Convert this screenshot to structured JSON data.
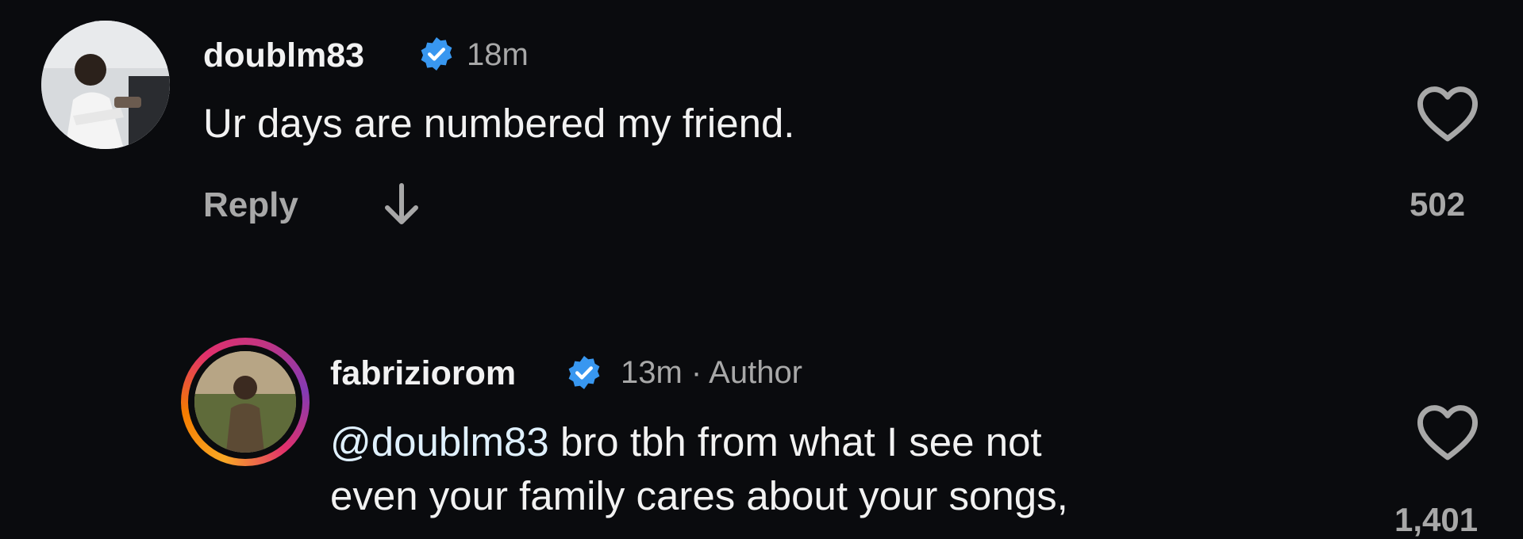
{
  "comments": [
    {
      "username": "doublm83",
      "time": "18m",
      "text": "Ur days are numbered my friend.",
      "reply_label": "Reply",
      "like_count": "502",
      "icons": [
        "avatar",
        "verified-badge-icon",
        "arrow-down-icon",
        "heart-icon"
      ]
    },
    {
      "username": "fabriziorom",
      "time": "13m · Author",
      "mention": "@doublm83",
      "text_line1": "bro tbh from what I see not",
      "text_line2": "even your family cares about your songs,",
      "like_count": "1,401",
      "icons": [
        "avatar",
        "verified-badge-icon",
        "heart-icon"
      ]
    }
  ],
  "colors": {
    "background": "#0a0b0e",
    "verified": "#3897f0",
    "muted": "#a8a8a8"
  }
}
